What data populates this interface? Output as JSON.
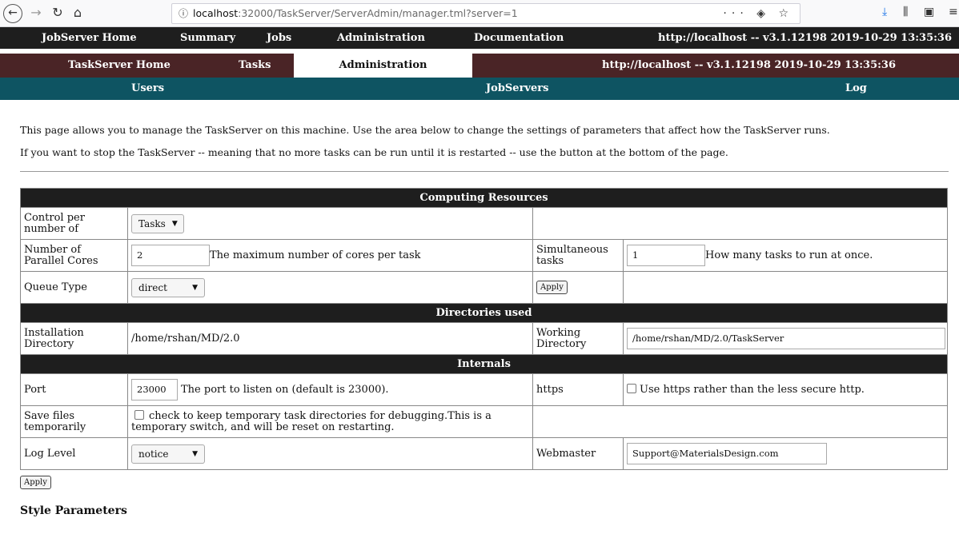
{
  "browser": {
    "url_prefix": "localhost",
    "url_rest": ":32000/TaskServer/ServerAdmin/manager.tml?server=1",
    "url_actions": "··· ◈ ☆"
  },
  "nav1": {
    "items": [
      "JobServer Home",
      "Summary",
      "Jobs",
      "Administration",
      "Documentation"
    ],
    "status": "http://localhost -- v3.1.12198  2019-10-29 13:35:36"
  },
  "nav2": {
    "items": [
      "TaskServer Home",
      "Tasks",
      "Administration"
    ],
    "status": "http://localhost -- v3.1.12198  2019-10-29 13:35:36"
  },
  "nav3": {
    "items": [
      "Users",
      "JobServers",
      "Log"
    ]
  },
  "intro": {
    "line1": "This page allows you to manage the TaskServer on this machine. Use the area below to change the settings of parameters that affect how the TaskServer runs.",
    "line2": "If you want to stop the TaskServer -- meaning that no more tasks can be run until it is restarted -- use the button at the bottom of the page."
  },
  "computing": {
    "heading": "Computing Resources",
    "control_label": "Control per number of",
    "control_value": "Tasks",
    "cores_label": "Number of Parallel Cores",
    "cores_value": "2",
    "cores_help": "The maximum number of cores per task",
    "simul_label": "Simultaneous tasks",
    "simul_value": "1",
    "simul_help": "How many tasks to run at once.",
    "queue_label": "Queue Type",
    "queue_value": "direct",
    "apply_label": "Apply"
  },
  "directories": {
    "heading": "Directories used",
    "install_label": "Installation Directory",
    "install_value": "/home/rshan/MD/2.0",
    "working_label": "Working Directory",
    "working_value": "/home/rshan/MD/2.0/TaskServer"
  },
  "internals": {
    "heading": "Internals",
    "port_label": "Port",
    "port_value": "23000",
    "port_help": "The port to listen on (default is 23000).",
    "https_label": "https",
    "https_help": "Use https rather than the less secure http.",
    "save_label": "Save files temporarily",
    "save_help": "check to keep temporary task directories for debugging.This is a temporary switch, and will be reset on restarting.",
    "log_label": "Log Level",
    "log_value": "notice",
    "webmaster_label": "Webmaster",
    "webmaster_value": "Support@MaterialsDesign.com"
  },
  "apply_bottom": "Apply",
  "style_params_heading": "Style Parameters"
}
